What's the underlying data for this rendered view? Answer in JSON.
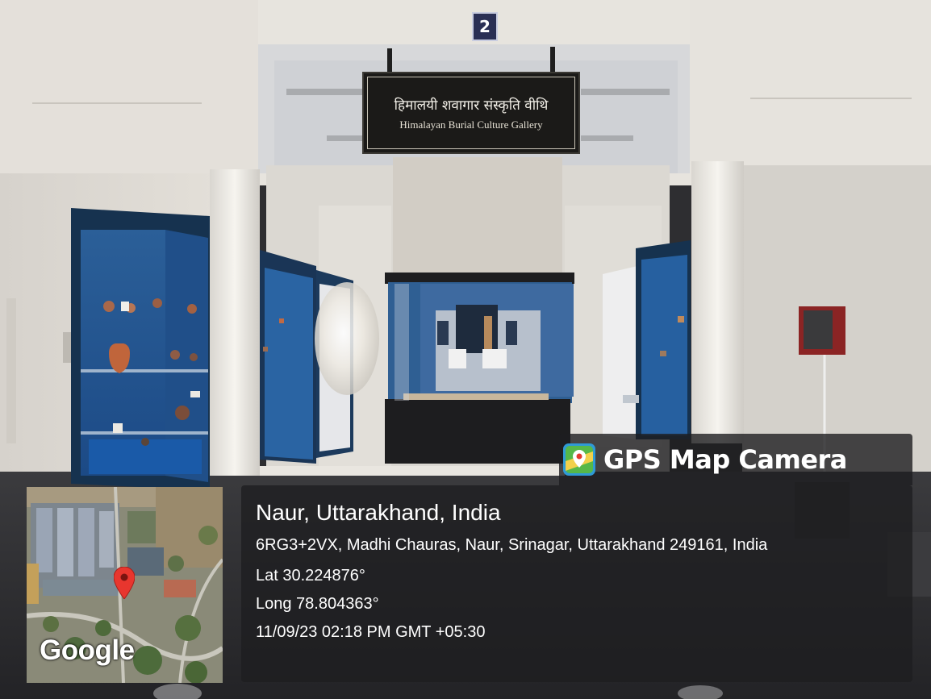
{
  "photo": {
    "gallery_number": "2",
    "sign_hindi": "हिमालयी शवागार संस्कृति वीथि",
    "sign_english": "Himalayan Burial Culture Gallery"
  },
  "overlay": {
    "brand": "GPS Map Camera",
    "map_attribution": "Google",
    "place_title": "Naur, Uttarakhand, India",
    "address": "6RG3+2VX, Madhi Chauras, Naur, Srinagar, Uttarakhand 249161, India",
    "latitude": "Lat 30.224876°",
    "longitude": "Long 78.804363°",
    "datetime": "11/09/23 02:18 PM GMT +05:30",
    "pin_color": "#e8362e",
    "panel_color": "#1e1e20"
  }
}
